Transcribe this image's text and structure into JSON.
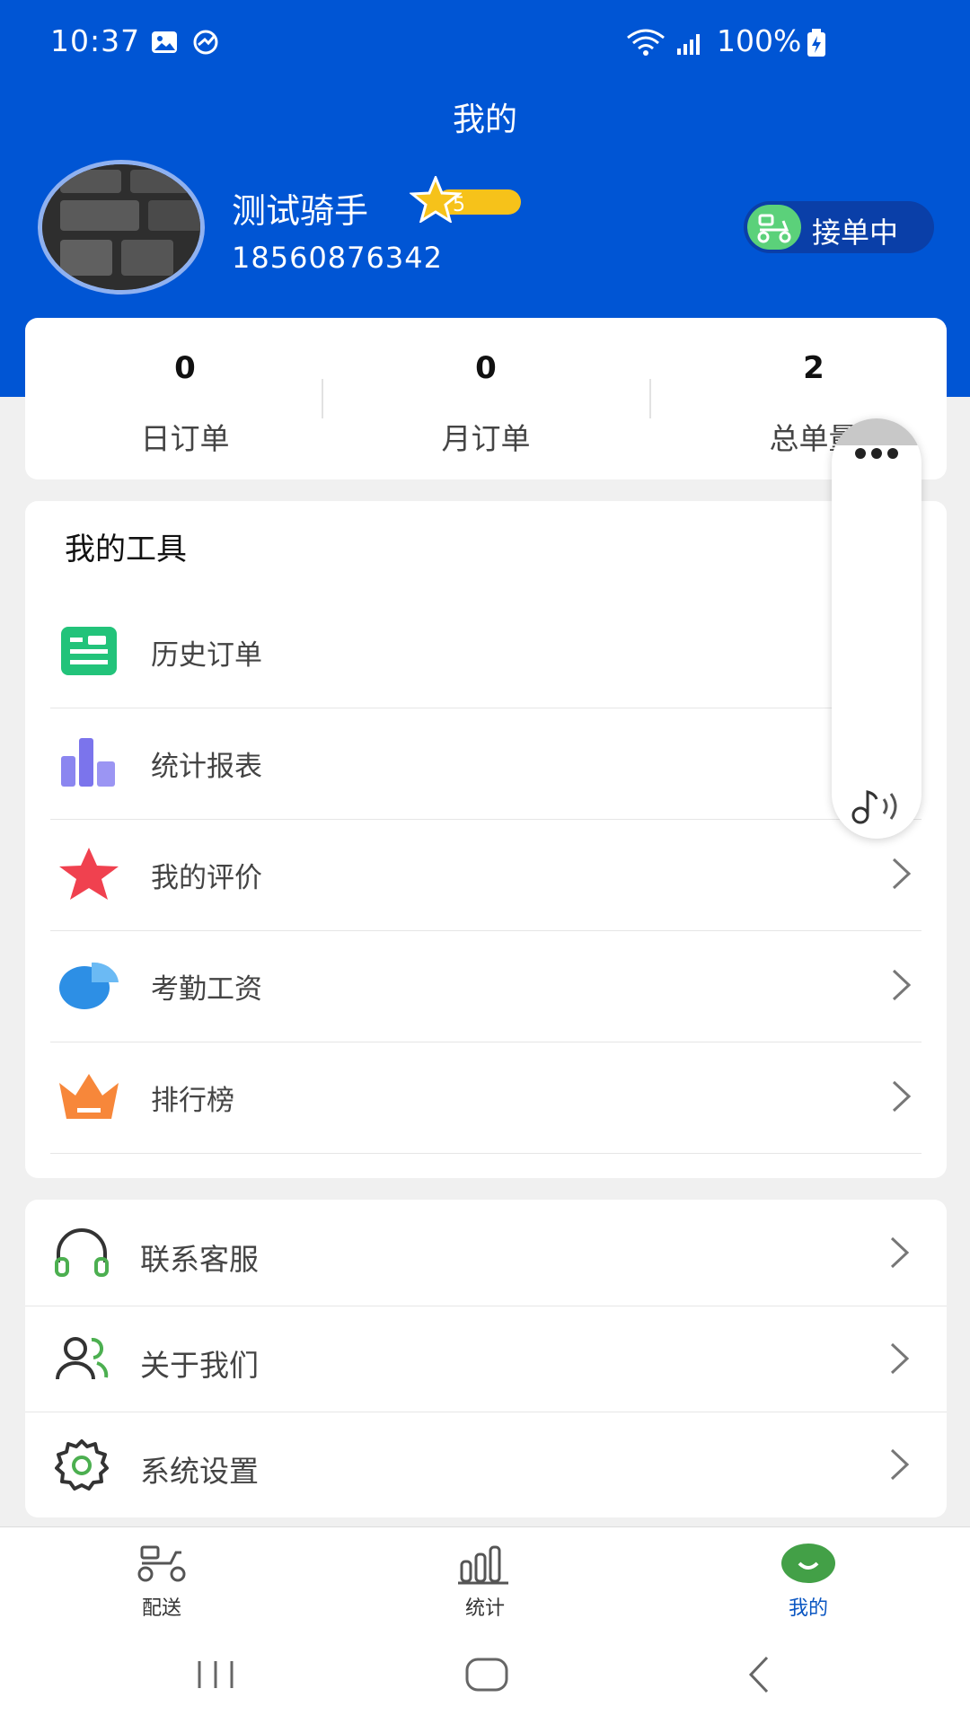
{
  "status_bar": {
    "time": "10:37",
    "battery": "100%"
  },
  "header": {
    "title": "我的"
  },
  "profile": {
    "name": "测试骑手",
    "level": "5",
    "phone": "18560876342",
    "status_label": "接单中"
  },
  "stats": [
    {
      "value": "0",
      "label": "日订单"
    },
    {
      "value": "0",
      "label": "月订单"
    },
    {
      "value": "2",
      "label": "总单量"
    }
  ],
  "tools": {
    "title": "我的工具",
    "items": [
      {
        "label": "历史订单",
        "icon": "list-icon"
      },
      {
        "label": "统计报表",
        "icon": "bar-chart-icon"
      },
      {
        "label": "我的评价",
        "icon": "star-icon"
      },
      {
        "label": "考勤工资",
        "icon": "pie-chart-icon"
      },
      {
        "label": "排行榜",
        "icon": "crown-icon"
      }
    ]
  },
  "misc": {
    "items": [
      {
        "label": "联系客服",
        "icon": "headset-icon"
      },
      {
        "label": "关于我们",
        "icon": "users-icon"
      },
      {
        "label": "系统设置",
        "icon": "gear-icon"
      }
    ]
  },
  "bottom_nav": {
    "items": [
      {
        "label": "配送",
        "icon": "scooter-icon"
      },
      {
        "label": "统计",
        "icon": "stats-icon"
      },
      {
        "label": "我的",
        "icon": "profile-icon",
        "active": true
      }
    ]
  },
  "colors": {
    "brand": "#0055d4",
    "accent_green": "#4caf50",
    "active_nav": "#0a56c2"
  }
}
